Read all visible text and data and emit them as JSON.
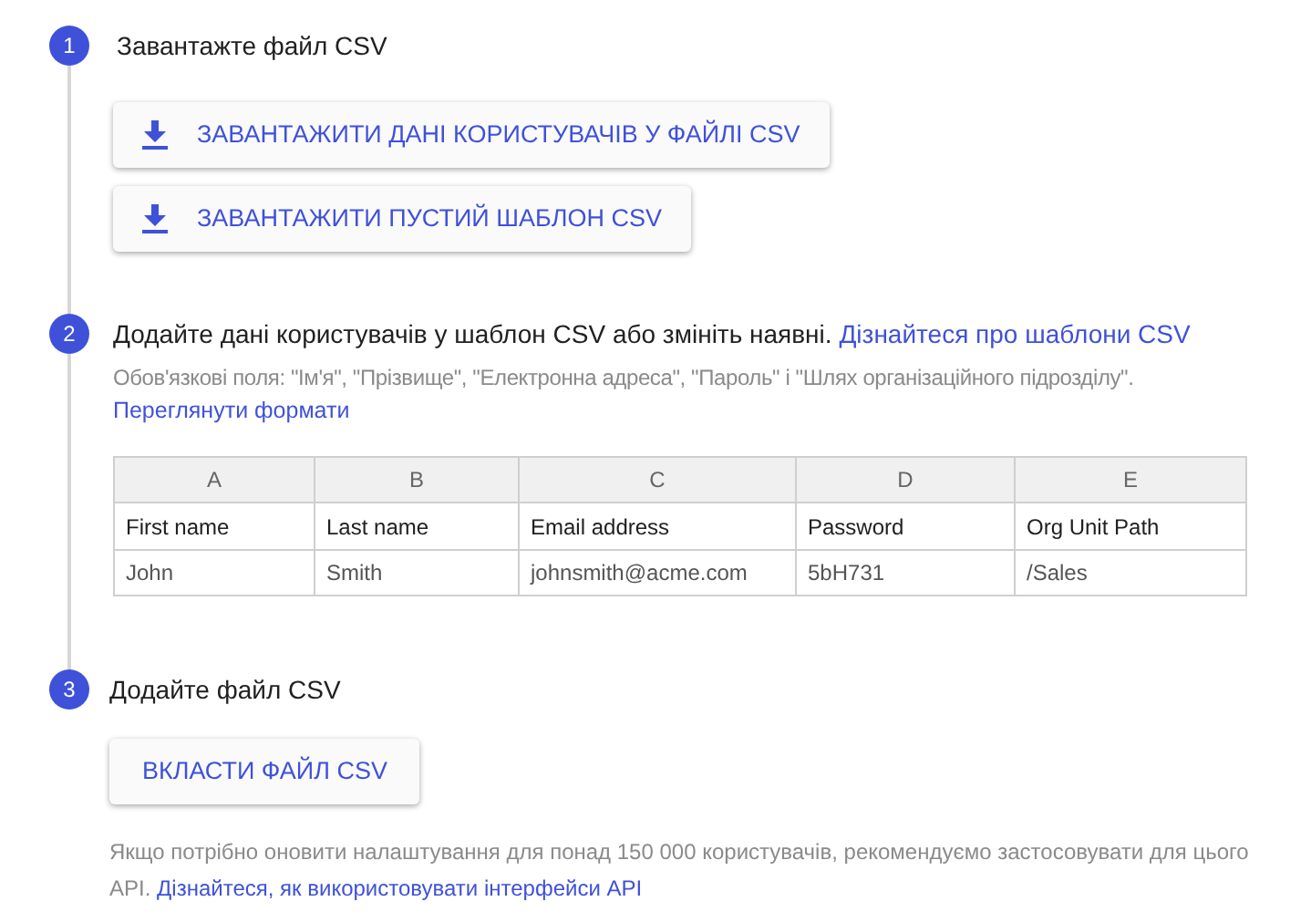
{
  "steps": [
    {
      "number": "1",
      "title": "Завантажте файл CSV",
      "buttons": [
        "ЗАВАНТАЖИТИ ДАНІ КОРИСТУВАЧІВ У ФАЙЛІ CSV",
        "ЗАВАНТАЖИТИ ПУСТИЙ ШАБЛОН CSV"
      ]
    },
    {
      "number": "2",
      "title": "Додайте дані користувачів у шаблон CSV або змініть наявні.",
      "title_link": "Дізнайтеся про шаблони CSV",
      "note": "Обов'язкові поля: \"Ім'я\", \"Прізвище\", \"Електронна адреса\", \"Пароль\" і \"Шлях організаційного підрозділу\".",
      "note_link": "Переглянути формати",
      "table": {
        "columns": [
          "A",
          "B",
          "C",
          "D",
          "E"
        ],
        "rows": [
          {
            "kind": "header",
            "cells": [
              "First name",
              "Last name",
              "Email address",
              "Password",
              "Org Unit Path"
            ]
          },
          {
            "kind": "data",
            "cells": [
              "John",
              "Smith",
              "johnsmith@acme.com",
              "5bH731",
              "/Sales"
            ]
          }
        ]
      }
    },
    {
      "number": "3",
      "title": "Додайте файл CSV",
      "buttons": [
        "ВКЛАСТИ ФАЙЛ CSV"
      ],
      "footer": "Якщо потрібно оновити налаштування для понад 150 000 користувачів, рекомендуємо застосовувати для цього API.",
      "footer_link": "Дізнайтеся, як використовувати інтерфейси API"
    }
  ]
}
